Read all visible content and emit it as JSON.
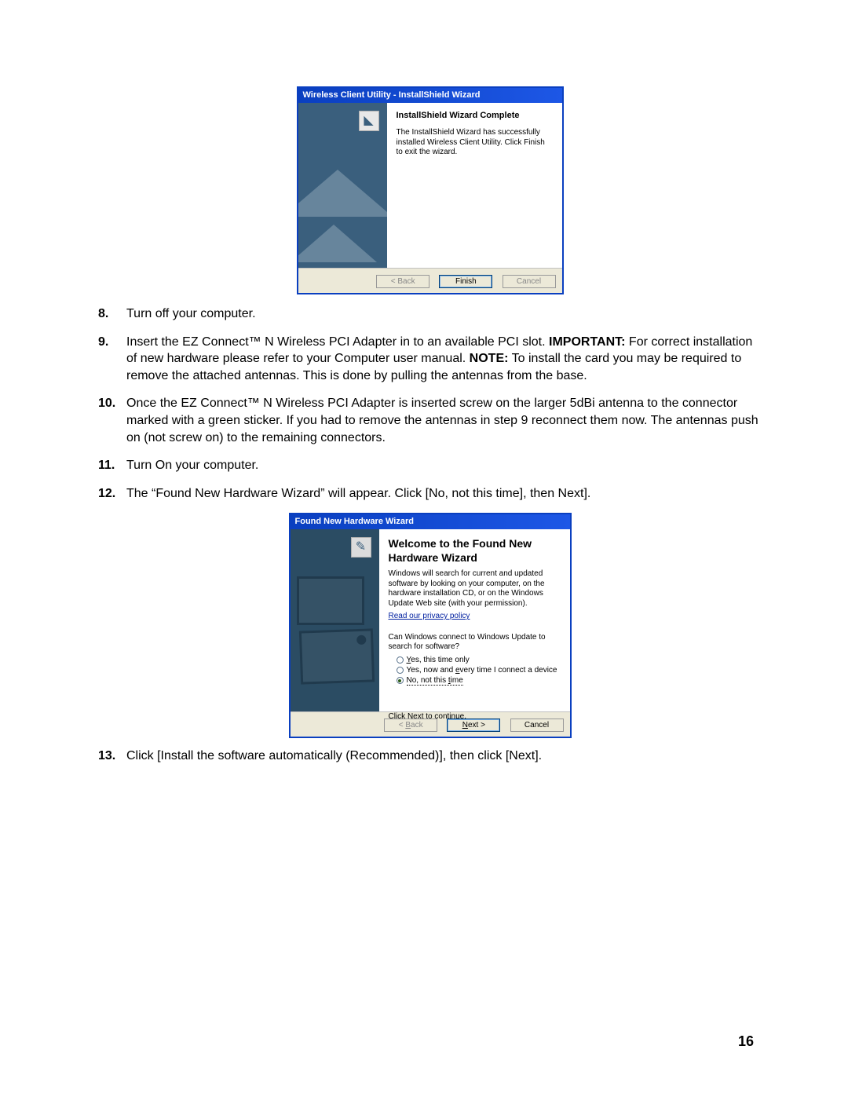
{
  "pageNumber": "16",
  "dialog1": {
    "title": "Wireless Client Utility - InstallShield Wizard",
    "heading": "InstallShield Wizard Complete",
    "body": "The InstallShield Wizard has successfully installed Wireless Client Utility. Click Finish to exit the wizard.",
    "buttons": {
      "back": "< Back",
      "finish": "Finish",
      "cancel": "Cancel"
    }
  },
  "steps": {
    "s8": {
      "num": "8.",
      "text": "Turn off your computer."
    },
    "s9": {
      "num": "9.",
      "p1": "Insert the EZ Connect™ N Wireless PCI Adapter in to an available PCI slot. ",
      "imp": "IMPORTANT:",
      "p2": " For correct installation of new hardware please refer to your Computer user manual. ",
      "note": "NOTE:",
      "p3": " To install the card you may be required to remove the attached antennas. This is done by pulling the antennas from the base."
    },
    "s10": {
      "num": "10.",
      "text": "Once the EZ Connect™ N Wireless PCI Adapter is inserted screw on the larger 5dBi antenna to the connector marked with a green sticker. If you had to remove the antennas in step 9 reconnect them now. The antennas push on (not screw on) to the remaining connectors."
    },
    "s11": {
      "num": "11.",
      "text": "Turn On your computer."
    },
    "s12": {
      "num": "12.",
      "text": "The “Found New Hardware Wizard” will appear. Click [No, not this time], then Next]."
    },
    "s13": {
      "num": "13.",
      "text": "Click [Install the software automatically (Recommended)], then click [Next]."
    }
  },
  "dialog2": {
    "title": "Found New Hardware Wizard",
    "heading": "Welcome to the Found New Hardware Wizard",
    "body1": "Windows will search for current and updated software by looking on your computer, on the hardware installation CD, or on the Windows Update Web site (with your permission).",
    "privacy": "Read our privacy policy",
    "question": "Can Windows connect to Windows Update to search for software?",
    "opt1": "Yes, this time only",
    "opt2": "Yes, now and every time I connect a device",
    "opt3": "No, not this time",
    "continue": "Click Next to continue.",
    "buttons": {
      "back": "< Back",
      "next": "Next >",
      "cancel": "Cancel"
    }
  }
}
